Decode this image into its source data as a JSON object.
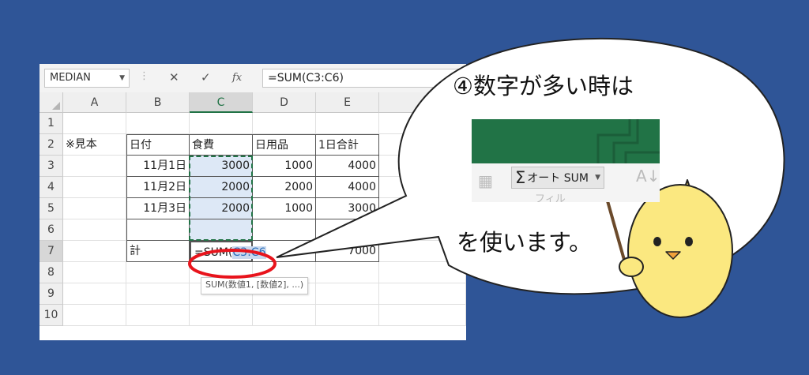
{
  "excel": {
    "name_box": "MEDIAN",
    "formula_bar": "=SUM(C3:C6)",
    "cancel_glyph": "✕",
    "enter_glyph": "✓",
    "fx_label": "fx",
    "columns": [
      "A",
      "B",
      "C",
      "D",
      "E"
    ],
    "rows": [
      "1",
      "2",
      "3",
      "4",
      "5",
      "6",
      "7",
      "8",
      "9",
      "10"
    ],
    "cells": {
      "a2": "※見本",
      "b2": "日付",
      "c2": "食費",
      "d2": "日用品",
      "e2": "1日合計",
      "b3": "11月1日",
      "c3": "3000",
      "d3": "1000",
      "e3": "4000",
      "b4": "11月2日",
      "c4": "2000",
      "d4": "2000",
      "e4": "4000",
      "b5": "11月3日",
      "c5": "2000",
      "d5": "1000",
      "e5": "3000",
      "b7": "計",
      "c7_prefix": "=SUM(",
      "c7_range": "C3:C6",
      "e7": "7000"
    },
    "tooltip": "SUM(数値1, [数値2], ...)"
  },
  "bubble": {
    "title": "④数字が多い時は",
    "body": "を使います。",
    "ribbon_button": "オート SUM",
    "ribbon_faded": "フィル"
  },
  "colors": {
    "background": "#2f5597",
    "excel_green": "#217346",
    "annotation_red": "#e8141c",
    "range_highlight": "#dde8f6",
    "chick_yellow": "#fbe880"
  }
}
